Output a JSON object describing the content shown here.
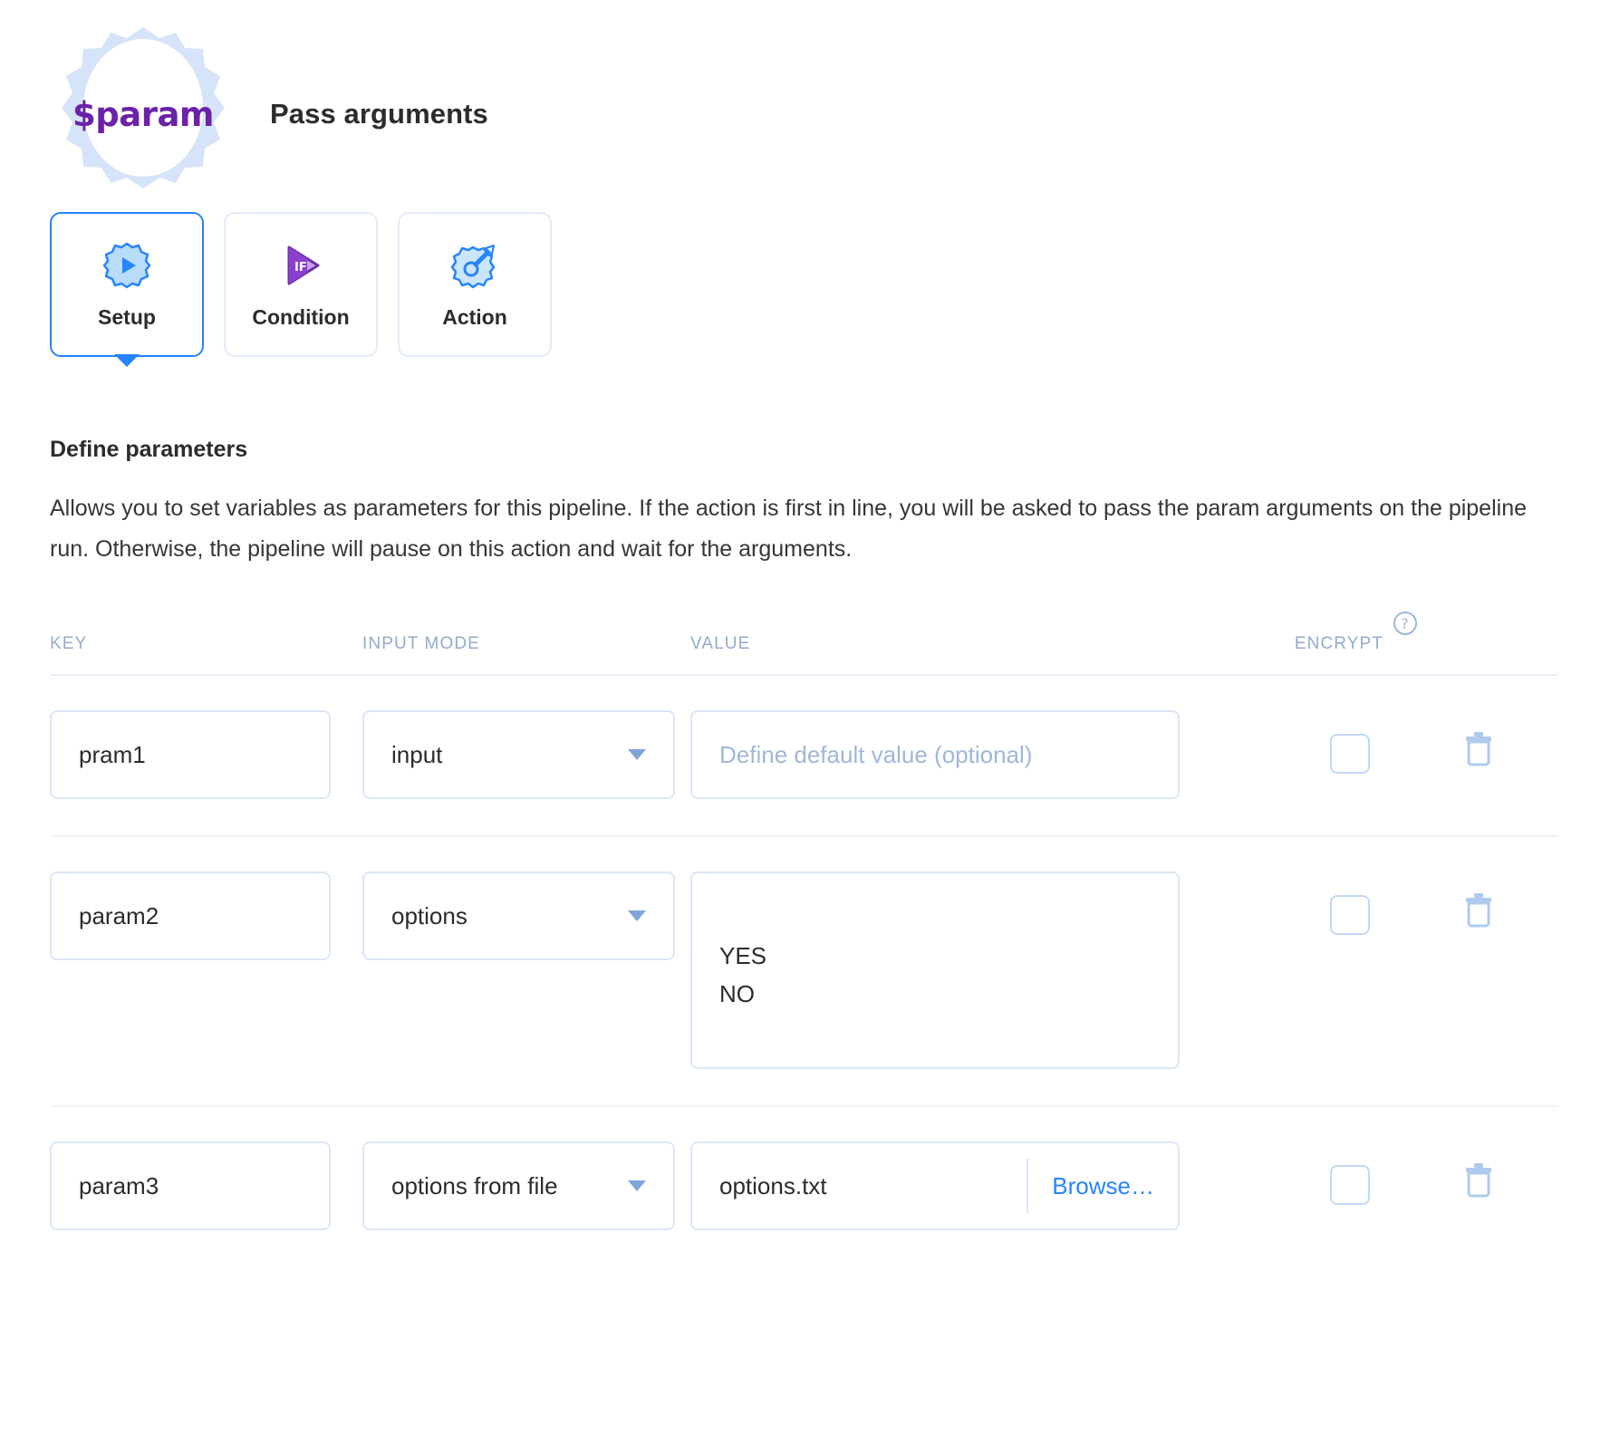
{
  "header": {
    "logo_text": "$param",
    "logo_name": "param-gear-logo",
    "title": "Pass arguments"
  },
  "tabs": [
    {
      "id": "setup",
      "label": "Setup",
      "icon": "gear-play-icon",
      "selected": true
    },
    {
      "id": "condition",
      "label": "Condition",
      "icon": "if-play-icon",
      "selected": false
    },
    {
      "id": "action",
      "label": "Action",
      "icon": "gear-wrench-icon",
      "selected": false
    }
  ],
  "section": {
    "title": "Define parameters",
    "description": "Allows you to set variables as parameters for this pipeline. If the action is first in line, you will be asked to pass the param arguments on the pipeline run. Otherwise, the pipeline will pause on this action and wait for the arguments."
  },
  "table": {
    "headers": {
      "key": "KEY",
      "input_mode": "INPUT MODE",
      "value": "VALUE",
      "encrypt": "ENCRYPT",
      "encrypt_help_icon": "question-mark-help-icon"
    },
    "rows": [
      {
        "key": "pram1",
        "input_mode": "input",
        "value_type": "placeholder",
        "value": "",
        "value_placeholder": "Define default value (optional)",
        "encrypt_checked": false
      },
      {
        "key": "param2",
        "input_mode": "options",
        "value_type": "textarea",
        "value": "YES\nNO",
        "value_placeholder": "",
        "encrypt_checked": false
      },
      {
        "key": "param3",
        "input_mode": "options from file",
        "value_type": "file",
        "value": "options.txt",
        "browse_label": "Browse…",
        "encrypt_checked": false
      }
    ],
    "delete_label": "trash-icon"
  },
  "colors": {
    "accent_blue": "#2684ff",
    "logo_purple": "#6b21a8",
    "logo_gear_blue": "#d5e4f8",
    "header_label": "#95aace",
    "border_light": "#dbe7f7",
    "condition_purple": "#8b3fd0"
  }
}
